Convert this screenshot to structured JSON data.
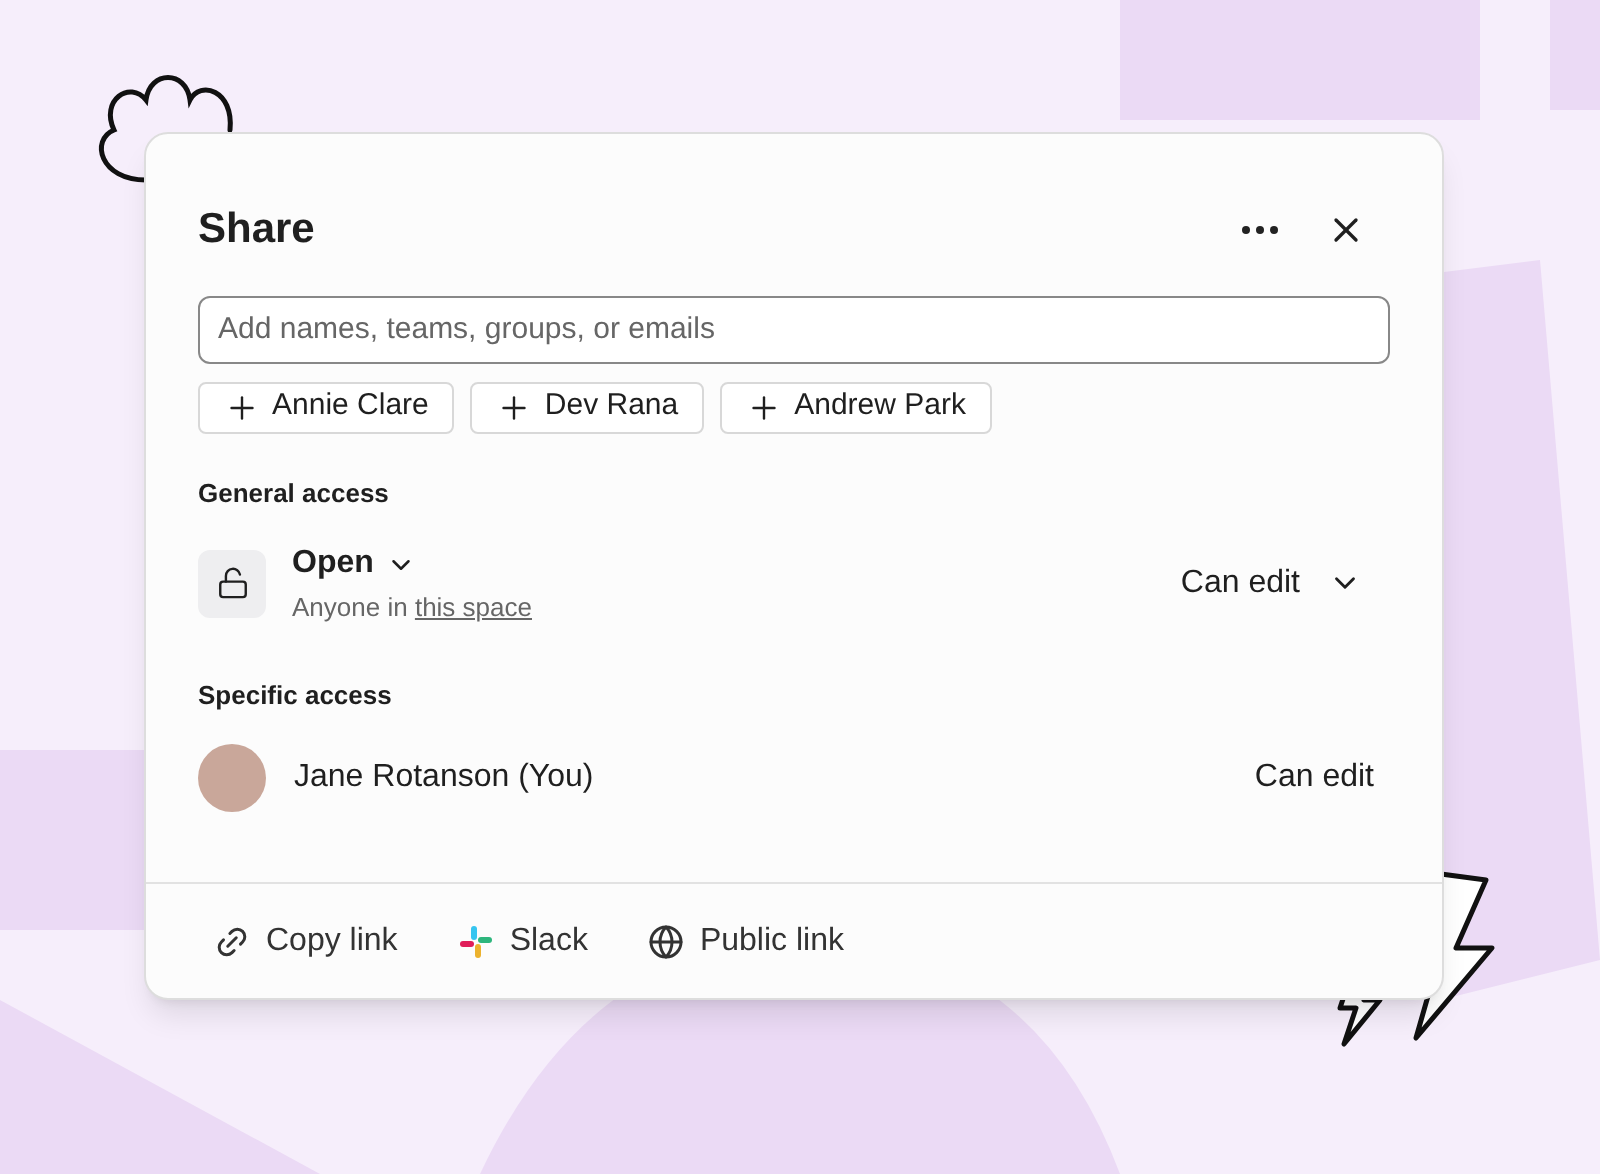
{
  "dialog": {
    "title": "Share"
  },
  "search": {
    "placeholder": "Add names, teams, groups, or emails"
  },
  "suggestions": [
    "Annie Clare",
    "Dev Rana",
    "Andrew Park"
  ],
  "general_access": {
    "heading": "General access",
    "option": "Open",
    "subtitle": "Anyone in",
    "subtitle_link": "this space",
    "permission": "Can edit"
  },
  "specific_access": {
    "heading": "Specific access",
    "members": [
      {
        "name": "Jane Rotanson (You)",
        "permission": "Can edit"
      }
    ]
  },
  "footer_actions": [
    {
      "kind": "link",
      "label": "Copy link"
    },
    {
      "kind": "slack",
      "label": "Slack"
    },
    {
      "kind": "globe",
      "label": "Public link"
    }
  ]
}
